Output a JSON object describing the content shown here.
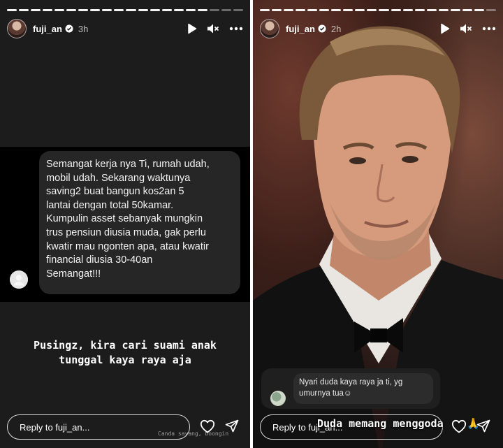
{
  "stories": [
    {
      "user": {
        "username": "fuji_an",
        "time_ago": "3h",
        "verified": true
      },
      "progress": {
        "segments_total": 20,
        "segments_complete": 17
      },
      "dm": {
        "text": "Semangat kerja nya Ti, rumah udah,\nmobil udah. Sekarang waktunya\nsaving2 buat bangun kos2an 5\nlantai dengan total 50kamar.\nKumpulin asset sebanyak mungkin\ntrus pensiun diusia muda, gak perlu\nkwatir mau ngonten apa, atau kwatir\nfinancial diusia 30-40an\nSemangat!!!"
      },
      "caption": "Pusingz, kira cari suami anak\ntunggal kaya raya aja",
      "reply": {
        "placeholder": "Reply to fuji_an..."
      },
      "watermark": "Canda sayang, boongin"
    },
    {
      "user": {
        "username": "fuji_an",
        "time_ago": "2h",
        "verified": true
      },
      "progress": {
        "segments_total": 20,
        "segments_complete": 19
      },
      "comment": {
        "text": "Nyari duda kaya raya ja ti, yg\numurnya tua☺"
      },
      "caption": "Duda memang menggoda",
      "caption_emoji": "🙏",
      "reply": {
        "placeholder": "Reply to fuji_an..."
      }
    }
  ],
  "icons": [
    "play-icon",
    "mute-icon",
    "more-icon",
    "verified-icon",
    "heart-icon",
    "send-icon"
  ],
  "colors": {
    "story_bg": "#1c1c1c",
    "dm_band": "#000000",
    "bubble": "#262626"
  }
}
